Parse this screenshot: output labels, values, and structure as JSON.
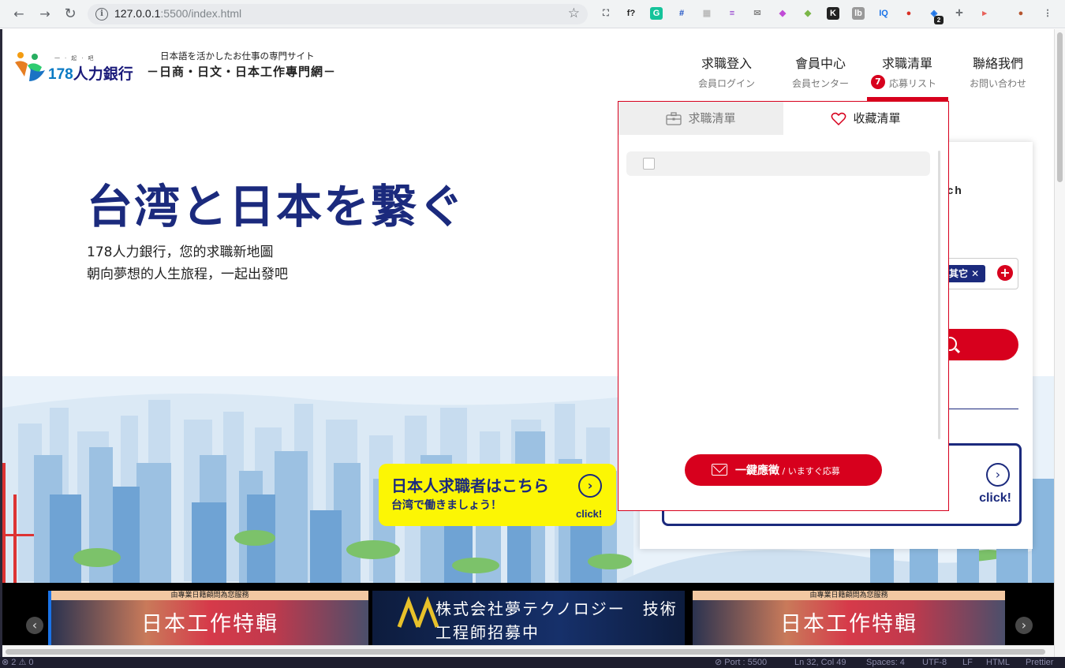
{
  "browser": {
    "url_host": "127.0.0.1",
    "url_rest": ":5500/index.html",
    "back_icon": "←",
    "forward_icon": "→",
    "reload_icon": "↻",
    "star_icon": "☆",
    "extensions": [
      {
        "name": "screenshot-icon",
        "glyph": "⛶",
        "color": "#5f6368",
        "bg": "transparent"
      },
      {
        "name": "font-icon",
        "glyph": "f?",
        "color": "#222",
        "bg": "transparent"
      },
      {
        "name": "grammarly-icon",
        "glyph": "G",
        "color": "#fff",
        "bg": "#15c39a"
      },
      {
        "name": "crop-icon",
        "glyph": "#",
        "color": "#1a4fc4",
        "bg": "transparent"
      },
      {
        "name": "grid-ext-icon",
        "glyph": "▦",
        "color": "#bbb",
        "bg": "transparent"
      },
      {
        "name": "menu-ext-icon",
        "glyph": "≡",
        "color": "#8b2fc9",
        "bg": "transparent"
      },
      {
        "name": "mail-ext-icon",
        "glyph": "✉",
        "color": "#888",
        "bg": "transparent"
      },
      {
        "name": "feather-ext-icon",
        "glyph": "◆",
        "color": "#c04bd6",
        "bg": "transparent"
      },
      {
        "name": "gem-ext-icon",
        "glyph": "◆",
        "color": "#7ab648",
        "bg": "transparent"
      },
      {
        "name": "k-ext-icon",
        "glyph": "K",
        "color": "#fff",
        "bg": "#222"
      },
      {
        "name": "lb-ext-icon",
        "glyph": "lb",
        "color": "#fff",
        "bg": "#999"
      },
      {
        "name": "iq-ext-icon",
        "glyph": "IQ",
        "color": "#1a73e8",
        "bg": "transparent"
      },
      {
        "name": "mic-ext-icon",
        "glyph": "●",
        "color": "#d93025",
        "bg": "transparent"
      },
      {
        "name": "badge-ext-icon",
        "glyph": "◈",
        "color": "#1a73e8",
        "bg": "transparent"
      },
      {
        "name": "move-ext-icon",
        "glyph": "✛",
        "color": "#5f6368",
        "bg": "transparent"
      },
      {
        "name": "record-ext-icon",
        "glyph": "▸",
        "color": "#e8615a",
        "bg": "transparent"
      },
      {
        "name": "profile-avatar-icon",
        "glyph": "●",
        "color": "#b5542e",
        "bg": "transparent"
      },
      {
        "name": "more-menu-icon",
        "glyph": "⋮",
        "color": "#5f6368",
        "bg": "transparent"
      }
    ],
    "ext_badge": "2"
  },
  "header": {
    "logo_num": "178",
    "logo_text": "人力銀行",
    "logo_dots": "一·起·吧",
    "tagline_jp": "日本語を活かしたお仕事の専門サイト",
    "tagline_cn": "－日商・日文・日本工作專門網－",
    "nav": [
      {
        "label": "求職登入",
        "sub": "会員ログイン"
      },
      {
        "label": "會員中心",
        "sub": "会員センター"
      },
      {
        "label": "求職清單",
        "sub": "応募リスト"
      },
      {
        "label": "聯絡我們",
        "sub": "お問い合わせ"
      }
    ],
    "job_list_badge": "7"
  },
  "hero": {
    "title": "台湾と日本を繋ぐ",
    "sub1": "178人力銀行，您的求職新地圖",
    "sub2": "朝向夢想的人生旅程，一起出發吧"
  },
  "search_card": {
    "label_partial": "rch",
    "tag_chip": "其它 ✕",
    "add_glyph": "+",
    "click_text": "click!",
    "arrow_glyph": "›"
  },
  "yellow_banner": {
    "line1": "日本人求職者はこちら",
    "line2": "台湾で働きましょう！",
    "click": "click!",
    "arrow_glyph": "›"
  },
  "dropdown": {
    "tab_jobs": "求職清單",
    "tab_favorites": "收藏清單",
    "apply_label": "一鍵應徵",
    "apply_sub": " / いますぐ応募"
  },
  "carousel": {
    "slides": [
      {
        "strip": "由專業日籍顧問為您服務",
        "title": "日本工作特輯"
      },
      {
        "strip": "",
        "title": "株式会社夢テクノロジー　技術工程師招募中"
      },
      {
        "strip": "由專業日籍顧問為您服務",
        "title": "日本工作特輯"
      }
    ],
    "prev_glyph": "‹",
    "next_glyph": "›"
  },
  "statusbar": {
    "left": "⊗ 2  ⚠ 0",
    "port": "⊘ Port : 5500",
    "position": "Ln 32, Col 49",
    "spaces": "Spaces: 4",
    "encoding": "UTF-8",
    "eol": "LF",
    "language": "HTML",
    "formatter": "Prettier"
  },
  "colors": {
    "brand_red": "#d7001d",
    "brand_navy": "#1b2a7d",
    "banner_yellow": "#fcf604"
  }
}
